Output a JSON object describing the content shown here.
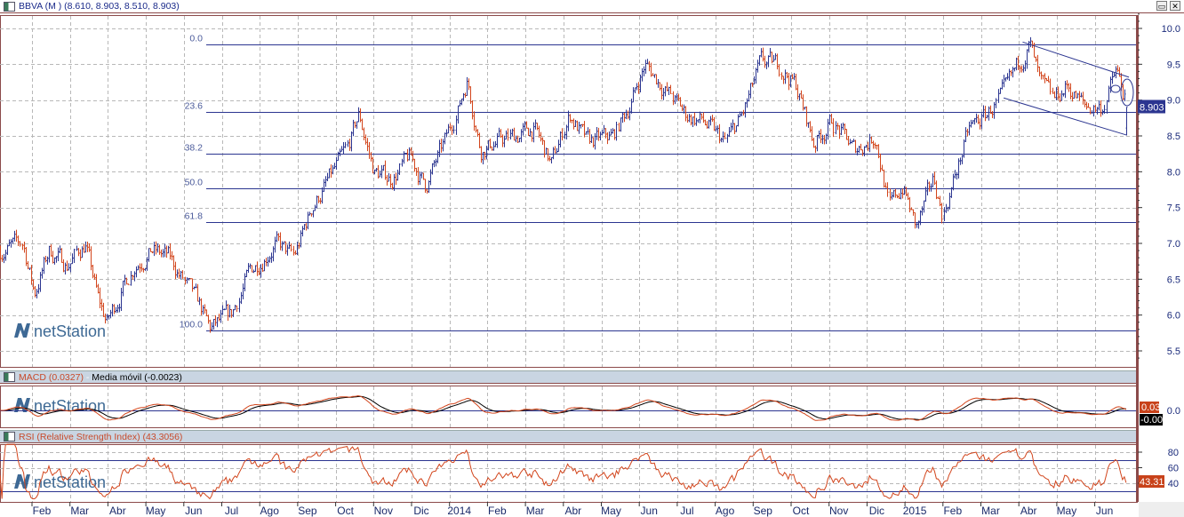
{
  "header": {
    "title": "BBVA (M ) (8.610, 8.903, 8.510, 8.903)"
  },
  "macd_header": {
    "macd_label": "MACD (0.0327)",
    "sep": " - ",
    "signal_label": "Media móvil (-0.0023)"
  },
  "rsi_header": {
    "label": "RSI (Relative Strength Index) (43.3056)"
  },
  "window_buttons": {
    "maximize": "▭",
    "close": "✕"
  },
  "watermark": "netStation",
  "colors": {
    "up": "#2b3590",
    "down": "#d2451c",
    "fib": "#2b3590",
    "grid": "#b8b8b8",
    "border": "#8b4a4a",
    "macd": "#d2451c",
    "signal": "#000000",
    "rsi": "#d2451c"
  },
  "chart_data": [
    {
      "type": "ohlc",
      "title": "BBVA (M )",
      "last": {
        "open": 8.61,
        "high": 8.903,
        "low": 8.51,
        "close": 8.903
      },
      "price_tag": "8.903",
      "ylim": [
        5.3,
        10.2
      ],
      "yticks": [
        "10.0",
        "9.5",
        "9.0",
        "8.5",
        "8.0",
        "7.5",
        "7.0",
        "6.5",
        "6.0",
        "5.5"
      ],
      "ytick_values": [
        10.0,
        9.5,
        9.0,
        8.5,
        8.0,
        7.5,
        7.0,
        6.5,
        6.0,
        5.5
      ],
      "x_unit": "months since Jan 2013",
      "xticks": [
        "Feb",
        "Mar",
        "Abr",
        "May",
        "Jun",
        "Jul",
        "Ago",
        "Sep",
        "Oct",
        "Nov",
        "Dic",
        "2014",
        "Feb",
        "Mar",
        "Abr",
        "May",
        "Jun",
        "Jul",
        "Ago",
        "Sep",
        "Oct",
        "Nov",
        "Dic",
        "2015",
        "Feb",
        "Mar",
        "Abr",
        "May",
        "Jun"
      ],
      "xtick_months": [
        1,
        2,
        3,
        4,
        5,
        6,
        7,
        8,
        9,
        10,
        11,
        12,
        13,
        14,
        15,
        16,
        17,
        18,
        19,
        20,
        21,
        22,
        23,
        24,
        25,
        26,
        27,
        28,
        29
      ],
      "close_path": [
        [
          0.16,
          6.9
        ],
        [
          0.75,
          7.0
        ],
        [
          1.05,
          6.3
        ],
        [
          1.45,
          6.9
        ],
        [
          1.92,
          6.7
        ],
        [
          2.39,
          7.0
        ],
        [
          2.74,
          6.2
        ],
        [
          2.97,
          5.9
        ],
        [
          3.33,
          6.3
        ],
        [
          3.68,
          6.7
        ],
        [
          4.15,
          6.9
        ],
        [
          4.61,
          6.8
        ],
        [
          5.08,
          6.4
        ],
        [
          5.43,
          6.1
        ],
        [
          5.67,
          5.8
        ],
        [
          6.25,
          6.0
        ],
        [
          6.72,
          6.6
        ],
        [
          7.42,
          7.0
        ],
        [
          7.89,
          6.8
        ],
        [
          8.36,
          7.5
        ],
        [
          8.95,
          8.0
        ],
        [
          9.3,
          8.3
        ],
        [
          9.6,
          8.8
        ],
        [
          10.0,
          8.0
        ],
        [
          10.47,
          7.9
        ],
        [
          10.94,
          8.2
        ],
        [
          11.36,
          7.8
        ],
        [
          11.87,
          8.4
        ],
        [
          12.22,
          8.9
        ],
        [
          12.46,
          9.3
        ],
        [
          12.81,
          8.3
        ],
        [
          13.16,
          8.4
        ],
        [
          13.75,
          8.5
        ],
        [
          14.22,
          8.6
        ],
        [
          14.68,
          8.1
        ],
        [
          15.15,
          8.8
        ],
        [
          15.62,
          8.4
        ],
        [
          16.32,
          8.5
        ],
        [
          16.79,
          9.0
        ],
        [
          17.14,
          9.5
        ],
        [
          17.61,
          9.2
        ],
        [
          18.2,
          8.8
        ],
        [
          18.67,
          8.7
        ],
        [
          19.25,
          8.4
        ],
        [
          19.72,
          8.8
        ],
        [
          20.19,
          9.5
        ],
        [
          20.66,
          9.5
        ],
        [
          21.12,
          9.2
        ],
        [
          21.59,
          8.4
        ],
        [
          22.06,
          8.7
        ],
        [
          22.65,
          8.3
        ],
        [
          23.23,
          8.5
        ],
        [
          23.58,
          7.5
        ],
        [
          23.93,
          7.8
        ],
        [
          24.29,
          7.2
        ],
        [
          24.76,
          7.9
        ],
        [
          24.99,
          7.4
        ],
        [
          25.34,
          8.0
        ],
        [
          25.69,
          8.6
        ],
        [
          26.16,
          8.8
        ],
        [
          26.63,
          9.1
        ],
        [
          26.98,
          9.5
        ],
        [
          27.28,
          9.8
        ],
        [
          27.56,
          9.2
        ],
        [
          27.91,
          9.0
        ],
        [
          28.27,
          9.2
        ],
        [
          28.74,
          8.9
        ],
        [
          29.2,
          8.9
        ],
        [
          29.55,
          9.4
        ],
        [
          29.86,
          8.903
        ]
      ],
      "fibonacci": [
        {
          "label": "0.0",
          "price": 9.78
        },
        {
          "label": "23.6",
          "price": 8.83
        },
        {
          "label": "38.2",
          "price": 8.25
        },
        {
          "label": "50.0",
          "price": 7.77
        },
        {
          "label": "61.8",
          "price": 7.3
        },
        {
          "label": "100.0",
          "price": 5.78
        }
      ],
      "trend_channel": {
        "upper": [
          [
            27.1,
            9.81
          ],
          [
            29.9,
            9.32
          ]
        ],
        "lower": [
          [
            26.6,
            9.03
          ],
          [
            29.85,
            8.51
          ]
        ]
      }
    },
    {
      "type": "line",
      "title": "MACD",
      "series": [
        {
          "name": "MACD",
          "last": 0.0327
        },
        {
          "name": "Media móvil",
          "last": -0.0023
        }
      ],
      "yticks": [
        "0.0"
      ],
      "tags": {
        "macd": "0.03",
        "signal": "-0.00"
      }
    },
    {
      "type": "line",
      "title": "RSI (Relative Strength Index)",
      "series": [
        {
          "name": "RSI",
          "last": 43.3056
        }
      ],
      "yticks": [
        "80",
        "60",
        "40"
      ],
      "ytick_values": [
        80,
        60,
        40
      ],
      "levels": [
        70,
        30
      ],
      "tag": "43.31"
    }
  ]
}
